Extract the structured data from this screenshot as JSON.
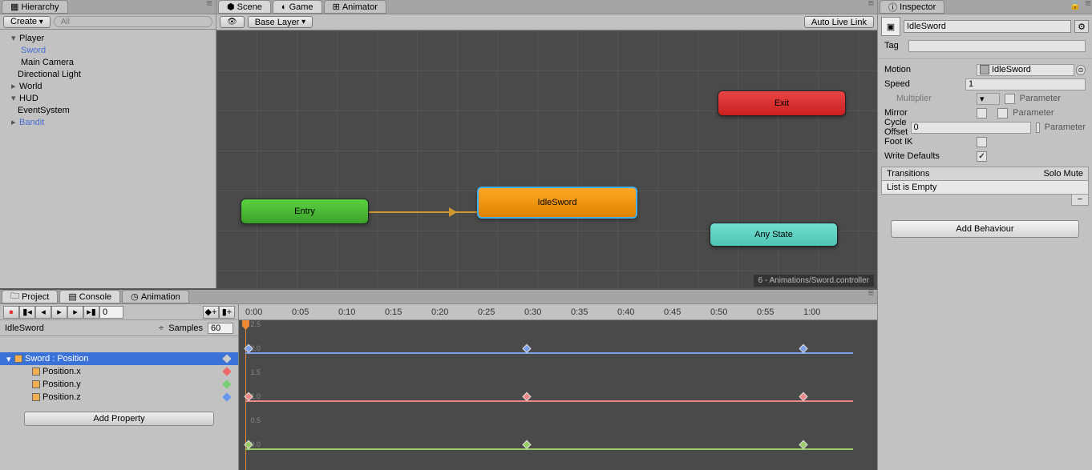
{
  "hierarchy": {
    "tab": "Hierarchy",
    "create_btn": "Create",
    "search_placeholder": "All",
    "items": [
      "Player",
      "Sword",
      "Main Camera",
      "Directional Light",
      "World",
      "HUD",
      "EventSystem",
      "Bandit"
    ]
  },
  "center": {
    "tabs": [
      "Scene",
      "Game",
      "Animator"
    ],
    "base_layer": "Base Layer",
    "auto_live_link": "Auto Live Link",
    "nodes": {
      "entry": "Entry",
      "idle": "IdleSword",
      "exit": "Exit",
      "any": "Any State"
    },
    "status": "6 - Animations/Sword.controller"
  },
  "inspector": {
    "tab": "Inspector",
    "name": "IdleSword",
    "tag_label": "Tag",
    "tag_value": "",
    "motion_label": "Motion",
    "motion_value": "IdleSword",
    "speed_label": "Speed",
    "speed_value": "1",
    "multiplier_label": "Multiplier",
    "multiplier_value": "",
    "mirror_label": "Mirror",
    "cycle_offset_label": "Cycle Offset",
    "cycle_offset_value": "0",
    "foot_ik_label": "Foot IK",
    "write_defaults_label": "Write Defaults",
    "parameter_label": "Parameter",
    "transitions": "Transitions",
    "solo_mute": "Solo Mute",
    "list_empty": "List is Empty",
    "add_behaviour": "Add Behaviour"
  },
  "bottom": {
    "tabs": [
      "Project",
      "Console",
      "Animation"
    ],
    "frame": "0",
    "clip": "IdleSword",
    "samples_label": "Samples",
    "samples": "60",
    "props": [
      "Sword : Position",
      "Position.x",
      "Position.y",
      "Position.z"
    ],
    "add_property": "Add Property",
    "ticks": [
      "0:00",
      "0:05",
      "0:10",
      "0:15",
      "0:20",
      "0:25",
      "0:30",
      "0:35",
      "0:40",
      "0:45",
      "0:50",
      "0:55",
      "1:00"
    ],
    "ylabels": [
      "2.5",
      "2.0",
      "1.5",
      "1.0",
      "0.5",
      "0.0"
    ],
    "keyframe_x": [
      8,
      355,
      700
    ]
  }
}
